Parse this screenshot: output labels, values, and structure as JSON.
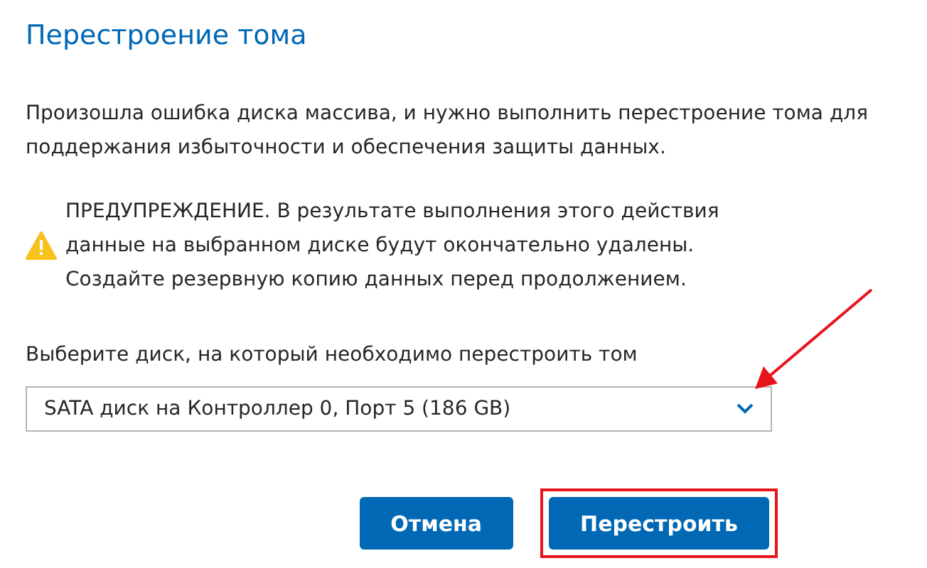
{
  "title": "Перестроение тома",
  "description": "Произошла ошибка диска массива, и нужно выполнить перестроение тома для поддержания избыточности и обеспечения защиты данных.",
  "warning": {
    "lines": [
      "ПРЕДУПРЕЖДЕНИЕ. В результате выполнения этого действия",
      "данные на выбранном диске будут окончательно удалены.",
      "Создайте резервную копию данных перед продолжением."
    ]
  },
  "disk_select": {
    "label": "Выберите диск, на который необходимо перестроить том",
    "value": "SATA диск на Контроллер 0, Порт 5 (186 GB)",
    "annotated": true
  },
  "buttons": [
    {
      "label": "Отмена",
      "highlighted": false
    },
    {
      "label": "Перестроить",
      "highlighted": true
    }
  ]
}
